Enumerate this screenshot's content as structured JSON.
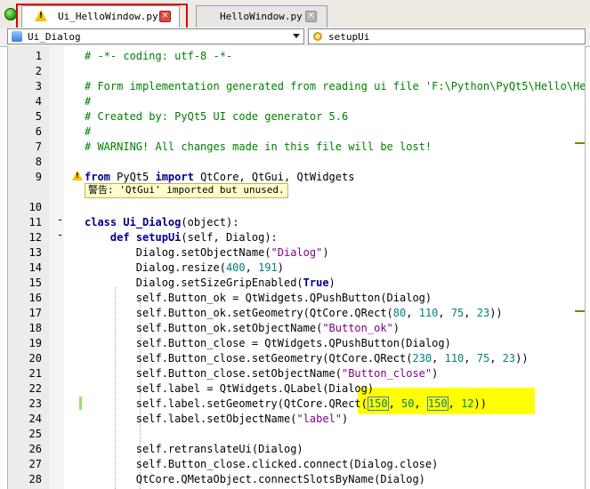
{
  "tabs": [
    {
      "label": "Ui_HelloWindow.py",
      "status_icon": "warning-icon",
      "active": true
    },
    {
      "label": "HelloWindow.py",
      "active": false
    }
  ],
  "close_glyph": "✕",
  "warning_glyph": "!",
  "toolbar": {
    "class_combo": "Ui_Dialog",
    "method_combo": "setupUi"
  },
  "editor": {
    "line_numbers": [
      "1",
      "2",
      "3",
      "4",
      "5",
      "6",
      "7",
      "8",
      "9",
      "10",
      "11",
      "12",
      "13",
      "14",
      "15",
      "16",
      "17",
      "18",
      "19",
      "20",
      "21",
      "22",
      "23",
      "24",
      "25",
      "26",
      "27",
      "28"
    ],
    "lines": [
      "# -*- coding: utf-8 -*-",
      "",
      "# Form implementation generated from reading ui file 'F:\\Python\\PyQt5\\Hello\\Hel",
      "#",
      "# Created by: PyQt5 UI code generator 5.6",
      "#",
      "# WARNING! All changes made in this file will be lost!",
      "",
      "from PyQt5 import QtCore, QtGui, QtWidgets",
      "",
      "class Ui_Dialog(object):",
      "    def setupUi(self, Dialog):",
      "        Dialog.setObjectName(\"Dialog\")",
      "        Dialog.resize(400, 191)",
      "        Dialog.setSizeGripEnabled(True)",
      "        self.Button_ok = QtWidgets.QPushButton(Dialog)",
      "        self.Button_ok.setGeometry(QtCore.QRect(80, 110, 75, 23))",
      "        self.Button_ok.setObjectName(\"Button_ok\")",
      "        self.Button_close = QtWidgets.QPushButton(Dialog)",
      "        self.Button_close.setGeometry(QtCore.QRect(230, 110, 75, 23))",
      "        self.Button_close.setObjectName(\"Button_close\")",
      "        self.label = QtWidgets.QLabel(Dialog)",
      "        self.label.setGeometry(QtCore.QRect(150, 50, 150, 12))",
      "        self.label.setObjectName(\"label\")",
      "",
      "        self.retranslateUi(Dialog)",
      "        self.Button_close.clicked.connect(Dialog.close)",
      "        QtCore.QMetaObject.connectSlotsByName(Dialog)"
    ],
    "fold_markers": [
      "-",
      "-"
    ],
    "warning_tooltip": "警告: 'QtGui' imported but unused."
  },
  "colors": {
    "keyword": "#00008b",
    "comment": "#008000",
    "string": "#7f007f",
    "number": "#007f7f",
    "highlight": "#ffff00",
    "tab_highlight_border": "#e00000"
  }
}
